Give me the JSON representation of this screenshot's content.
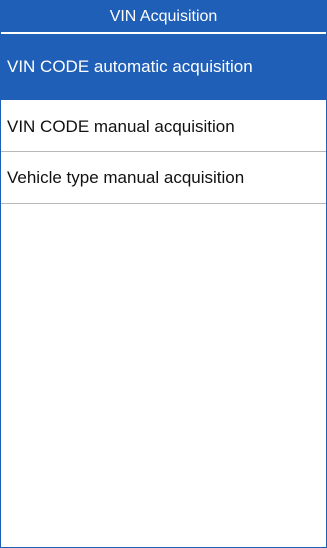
{
  "header": {
    "title": "VIN Acquisition"
  },
  "menu": {
    "items": [
      {
        "label": "VIN CODE automatic acquisition",
        "selected": true
      },
      {
        "label": "VIN CODE manual acquisition",
        "selected": false
      },
      {
        "label": "Vehicle type manual acquisition",
        "selected": false
      }
    ]
  },
  "colors": {
    "accent": "#1f5fb8",
    "divider": "#b8b8b8",
    "text": "#111111",
    "background": "#ffffff"
  }
}
